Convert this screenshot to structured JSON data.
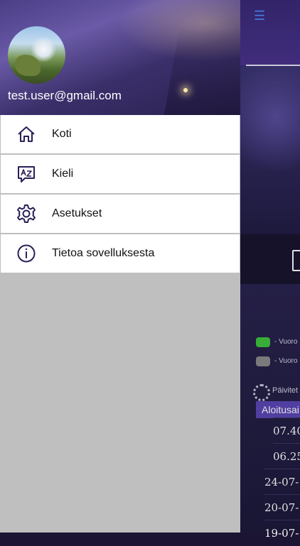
{
  "drawer": {
    "user_email": "test.user@gmail.com",
    "items": [
      {
        "label": "Koti",
        "icon": "home-icon"
      },
      {
        "label": "Kieli",
        "icon": "translate-icon"
      },
      {
        "label": "Asetukset",
        "icon": "gear-icon"
      },
      {
        "label": "Tietoa sovelluksesta",
        "icon": "info-icon"
      }
    ]
  },
  "background_app": {
    "menu_icon": "hamburger-icon",
    "legend": [
      {
        "text": "- Vuoro",
        "icon": "taxi-green-icon"
      },
      {
        "text": "- Vuoro",
        "icon": "taxi-grey-icon"
      }
    ],
    "updating_text": "Päivitet",
    "table_header": "Aloitusai",
    "rows": [
      "07.40",
      "06.25",
      "24-07-1",
      "20-07-1",
      "19-07-1"
    ]
  },
  "colors": {
    "accent": "#5c47b8",
    "icon_stroke": "#2b1f57",
    "taxi_active": "#3fc43f",
    "taxi_inactive": "#8b8b8b"
  }
}
